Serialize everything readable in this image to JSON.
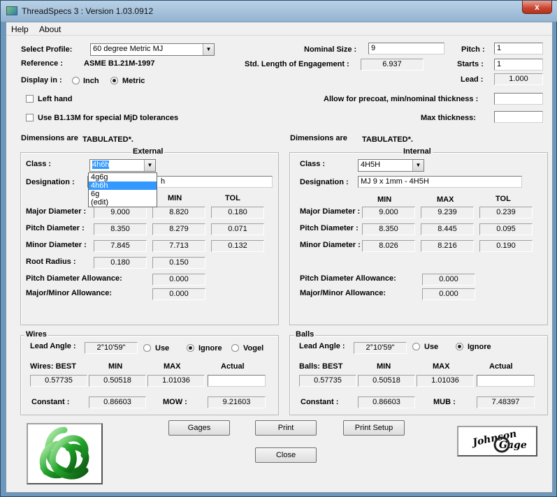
{
  "window": {
    "title": "ThreadSpecs 3 : Version 1.03.0912",
    "close_glyph": "x"
  },
  "menu": {
    "help": "Help",
    "about": "About"
  },
  "profile": {
    "label": "Select Profile:",
    "value": "60 degree Metric MJ"
  },
  "reference": {
    "label": "Reference :",
    "value": "ASME B1.21M-1997"
  },
  "display": {
    "label": "Display in :",
    "inch": "Inch",
    "metric": "Metric",
    "selected": "metric"
  },
  "left_hand": {
    "label": "Left hand",
    "checked": false
  },
  "b113m": {
    "label": "Use B1.13M for special MjD tolerances",
    "checked": false
  },
  "nominal": {
    "label": "Nominal Size :",
    "value": "9"
  },
  "std_length": {
    "label": "Std. Length of Engagement :",
    "value": "6.937"
  },
  "pitch": {
    "label": "Pitch :",
    "value": "1"
  },
  "starts": {
    "label": "Starts :",
    "value": "1"
  },
  "lead": {
    "label": "Lead :",
    "value": "1.000"
  },
  "precoat": {
    "label": "Allow for precoat, min/nominal thickness :",
    "value": ""
  },
  "max_thickness": {
    "label": "Max thickness:",
    "value": ""
  },
  "dims_left": {
    "label": "Dimensions are",
    "status": "TABULATED*."
  },
  "dims_right": {
    "label": "Dimensions are",
    "status": "TABULATED*."
  },
  "external": {
    "legend": "External",
    "class_label": "Class :",
    "class_value": "4h6h",
    "class_options": [
      "4g6g",
      "4h6h",
      "6g",
      "(edit)"
    ],
    "class_selected_index": 1,
    "designation_label": "Designation :",
    "designation_value": "h",
    "col_min": "MIN",
    "col_tol": "TOL",
    "rows": [
      {
        "label": "Major Diameter :",
        "max": "9.000",
        "min": "8.820",
        "tol": "0.180"
      },
      {
        "label": "Pitch Diameter :",
        "max": "8.350",
        "min": "8.279",
        "tol": "0.071"
      },
      {
        "label": "Minor Diameter :",
        "max": "7.845",
        "min": "7.713",
        "tol": "0.132"
      }
    ],
    "root_radius": {
      "label": "Root Radius :",
      "a": "0.180",
      "b": "0.150"
    },
    "pd_allowance": {
      "label": "Pitch Diameter Allowance:",
      "value": "0.000"
    },
    "mm_allowance": {
      "label": "Major/Minor Allowance:",
      "value": "0.000"
    }
  },
  "internal": {
    "legend": "Internal",
    "class_label": "Class :",
    "class_value": "4H5H",
    "designation_label": "Designation :",
    "designation_value": "MJ 9 x 1mm - 4H5H",
    "col_min": "MIN",
    "col_max": "MAX",
    "col_tol": "TOL",
    "rows": [
      {
        "label": "Major Diameter :",
        "min": "9.000",
        "max": "9.239",
        "tol": "0.239"
      },
      {
        "label": "Pitch Diameter :",
        "min": "8.350",
        "max": "8.445",
        "tol": "0.095"
      },
      {
        "label": "Minor Diameter :",
        "min": "8.026",
        "max": "8.216",
        "tol": "0.190"
      }
    ],
    "pd_allowance": {
      "label": "Pitch Diameter Allowance:",
      "value": "0.000"
    },
    "mm_allowance": {
      "label": "Major/Minor Allowance:",
      "value": "0.000"
    }
  },
  "wires": {
    "legend": "Wires",
    "lead_angle_label": "Lead Angle :",
    "lead_angle": "2°10'59\"",
    "use": "Use",
    "ignore": "Ignore",
    "vogel": "Vogel",
    "selected": "ignore",
    "best_label": "Wires: BEST",
    "min_label": "MIN",
    "max_label": "MAX",
    "actual_label": "Actual",
    "best": "0.57735",
    "min": "0.50518",
    "max": "1.01036",
    "actual": "",
    "constant_label": "Constant :",
    "constant": "0.86603",
    "mow_label": "MOW :",
    "mow": "9.21603"
  },
  "balls": {
    "legend": "Balls",
    "lead_angle_label": "Lead Angle :",
    "lead_angle": "2°10'59\"",
    "use": "Use",
    "ignore": "Ignore",
    "selected": "ignore",
    "best_label": "Balls: BEST",
    "min_label": "MIN",
    "max_label": "MAX",
    "actual_label": "Actual",
    "best": "0.57735",
    "min": "0.50518",
    "max": "1.01036",
    "actual": "",
    "constant_label": "Constant :",
    "constant": "0.86603",
    "mub_label": "MUB :",
    "mub": "7.48397"
  },
  "buttons": {
    "gages": "Gages",
    "print": "Print",
    "print_setup": "Print Setup",
    "close": "Close"
  },
  "logo_right": {
    "text1": "Johnson",
    "text2": "Gage"
  },
  "colors": {
    "selection": "#3399ff",
    "logo_green": "#22a32a"
  }
}
